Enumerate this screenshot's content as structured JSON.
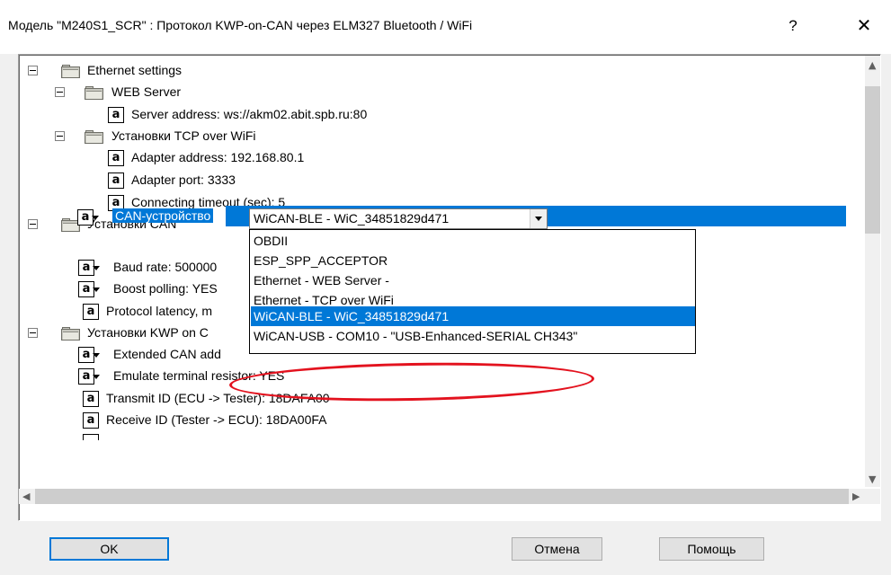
{
  "window": {
    "title": "Модель \"M240S1_SCR\" : Протокол KWP-on-CAN через ELM327 Bluetooth / WiFi",
    "help_glyph": "?",
    "close_glyph": "✕"
  },
  "tree": {
    "ethernet_settings": "Ethernet settings",
    "web_server": "WEB Server",
    "server_address": "Server address: ws://akm02.abit.spb.ru:80",
    "tcp_over_wifi": "Установки TCP over WiFi",
    "adapter_address": "Adapter address: 192.168.80.1",
    "adapter_port": "Adapter port: 3333",
    "connecting_timeout": "Connecting timeout (sec): 5",
    "can_settings": "Установки CAN",
    "can_device": "CAN-устройство",
    "baud_rate": "Baud rate: 500000",
    "boost_polling": "Boost polling: YES",
    "protocol_latency": "Protocol latency, m",
    "kwp_settings": "Установки KWP on C",
    "extended_can": "Extended CAN add",
    "emulate_resistor": "Emulate terminal resistor: YES",
    "transmit_id": "Transmit ID (ECU -> Tester): 18DAFA00",
    "receive_id": "Receive ID (Tester -> ECU): 18DA00FA",
    "icon_letter": "a"
  },
  "combo": {
    "value": "WiCAN-BLE - WiC_34851829d471"
  },
  "dropdown": {
    "options": [
      "OBDII",
      "ESP_SPP_ACCEPTOR",
      "Ethernet - WEB Server -",
      "Ethernet - TCP over WiFi",
      "WiCAN-BLE - WiC_34851829d471",
      "WiCAN-USB - COM10 - \"USB-Enhanced-SERIAL CH343\""
    ],
    "selected_index": 4
  },
  "buttons": {
    "ok": "OK",
    "cancel": "Отмена",
    "help": "Помощь"
  },
  "colors": {
    "selection": "#0078d7",
    "highlight_ellipse": "#e3121e"
  }
}
